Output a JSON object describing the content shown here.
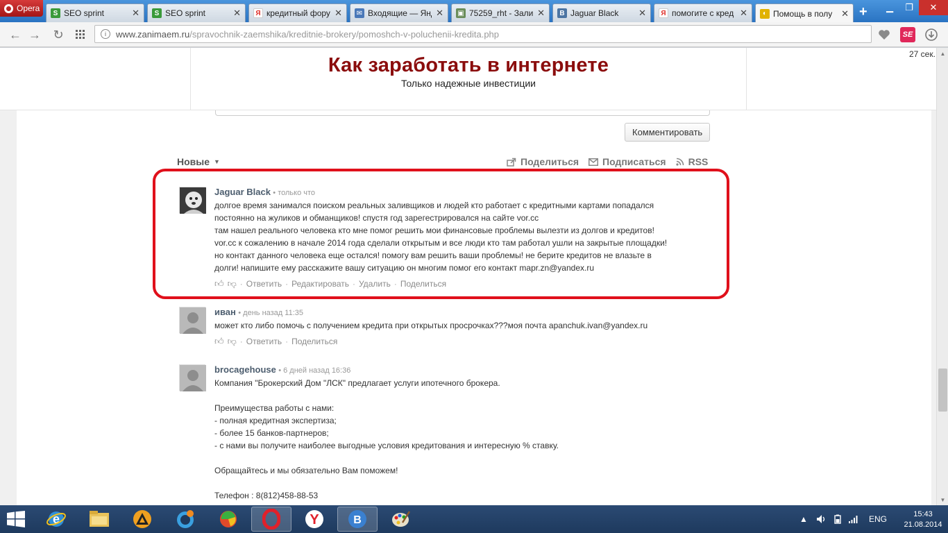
{
  "browser": {
    "menu_label": "Opera",
    "tabs": [
      {
        "label": "SEO sprint",
        "favicon": "S",
        "favicon_color": "#3a9a3a"
      },
      {
        "label": "SEO sprint",
        "favicon": "S",
        "favicon_color": "#3a9a3a"
      },
      {
        "label": "кредитный фору",
        "favicon": "Я",
        "favicon_color": "#e0302a"
      },
      {
        "label": "Входящие — Янд",
        "favicon": "✉",
        "favicon_color": "#4a78b8"
      },
      {
        "label": "75259_rht - Зали",
        "favicon": "▣",
        "favicon_color": "#6a8d5a"
      },
      {
        "label": "Jaguar Black",
        "favicon": "В",
        "favicon_color": "#4c75a3"
      },
      {
        "label": "помогите с кред",
        "favicon": "Я",
        "favicon_color": "#e0302a"
      },
      {
        "label": "Помощь в полу",
        "favicon": "◐",
        "favicon_color": "#e1b200"
      }
    ],
    "new_tab_label": "+",
    "url_domain": "www.zanimaem.ru",
    "url_path": "/spravochnik-zaemshika/kreditnie-brokery/pomoshch-v-poluchenii-kredita.php"
  },
  "site": {
    "title": "Как заработать в интернете",
    "tagline": "Только надежные инвестиции",
    "timer": "27 сек."
  },
  "comments_widget": {
    "submit_label": "Комментировать",
    "sort_label": "Новые",
    "share_label": "Поделиться",
    "subscribe_label": "Подписаться",
    "rss_label": "RSS",
    "comments": [
      {
        "author": "Jaguar Black",
        "time": "только что",
        "text": "долгое время занимался поиском реальных заливщиков и людей кто работает с кредитными картами попадался\nпостоянно на жуликов и обманщиков! спустя год зарегестрировался на сайте vor.cc\nтам нашел реального человека кто мне помог решить мои финансовые проблемы вылезти из долгов и кредитов!\nvor.cc к сожалению в начале 2014 года сделали открытым и все люди кто там работал ушли на закрытые площадки!\nно контакт данного человека еще остался! помогу вам решить ваши проблемы! не берите кредитов не влазьте в\nдолги! напишите ему расскажите вашу ситуацию он многим помог его контакт mapr.zn@yandex.ru",
        "actions": [
          "Ответить",
          "Редактировать",
          "Удалить",
          "Поделиться"
        ]
      },
      {
        "author": "иван",
        "time": "день назад 11:35",
        "text": "может кто либо помочь с получением кредита при открытых просрочках???моя почта apanchuk.ivan@yandex.ru",
        "actions": [
          "Ответить",
          "Поделиться"
        ]
      },
      {
        "author": "brocagehouse",
        "time": "6 дней назад 16:36",
        "text": "Компания \"Брокерский Дом \"ЛСК\" предлагает услуги ипотечного брокера.\n\nПреимущества работы с нами:\n- полная кредитная экспертиза;\n- более 15 банков-партнеров;\n- с нами вы получите наиболее выгодные условия кредитования и интересную % ставку.\n\nОбращайтесь и мы обязательно Вам поможем!\n\nТелефон : 8(812)458-88-53",
        "actions": []
      }
    ]
  },
  "taskbar": {
    "language": "ENG",
    "time": "15:43",
    "date": "21.08.2014"
  }
}
